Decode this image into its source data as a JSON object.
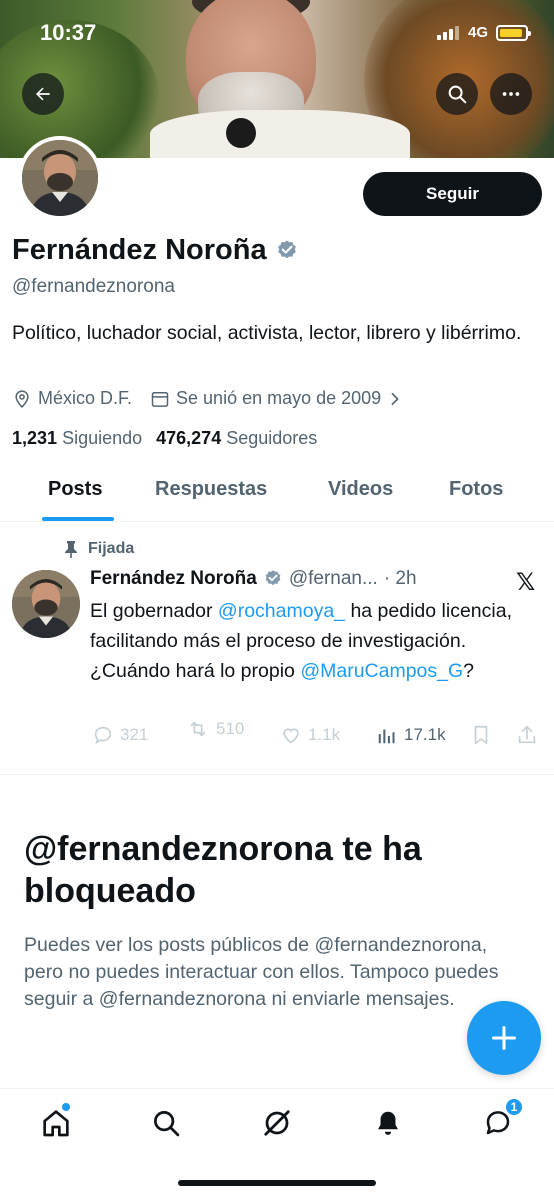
{
  "status_bar": {
    "time": "10:37",
    "network": "4G"
  },
  "profile": {
    "name": "Fernández Noroña",
    "handle": "@fernandeznorona",
    "bio": "Político, luchador social, activista, lector, librero y libérrimo.",
    "location": "México D.F.",
    "joined": "Se unió en mayo de 2009",
    "following_count": "1,231",
    "following_label": "Siguiendo",
    "followers_count": "476,274",
    "followers_label": "Seguidores",
    "follow_button": "Seguir",
    "verified": true
  },
  "tabs": [
    {
      "label": "Posts",
      "active": true
    },
    {
      "label": "Respuestas",
      "active": false
    },
    {
      "label": "Videos",
      "active": false
    },
    {
      "label": "Fotos",
      "active": false
    }
  ],
  "pinned_post": {
    "pinned_label": "Fijada",
    "author": "Fernández Noroña",
    "handle": "@fernan...",
    "time": "· 2h",
    "text_1": "El gobernador ",
    "mention_1": "@rochamoya_",
    "text_2": " ha pedido licencia, facilitando más el proceso de investigación. ¿Cuándo hará lo propio ",
    "mention_2": "@MaruCampos_G",
    "text_3": "?",
    "replies": "321",
    "reposts": "510",
    "likes": "1.1k",
    "views": "17.1k",
    "x_logo": "𝕏"
  },
  "blocked": {
    "title": "@fernandeznorona te ha bloqueado",
    "message": "Puedes ver los posts públicos de @fernandeznorona, pero no puedes interactuar con ellos. Tampoco puedes seguir a @fernandeznorona ni enviarle mensajes."
  },
  "bottom_nav": {
    "items": [
      "home-icon",
      "search-icon",
      "grok-icon",
      "notifications-icon",
      "messages-icon"
    ],
    "messages_badge": "1"
  },
  "colors": {
    "accent": "#1d9bf0",
    "text": "#0f1419",
    "muted": "#536471",
    "battery": "#f7d12a"
  }
}
